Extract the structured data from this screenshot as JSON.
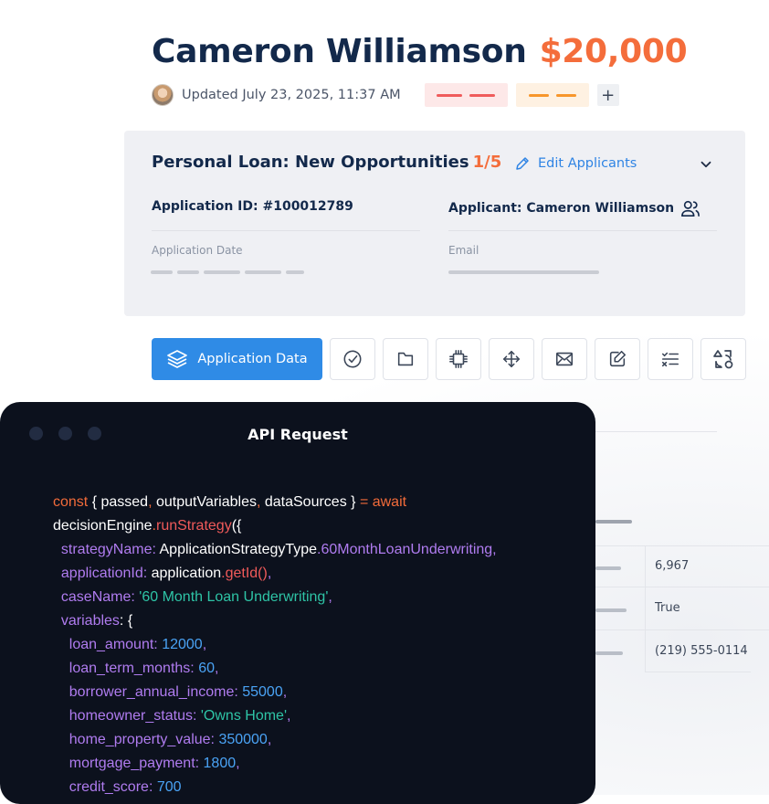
{
  "header": {
    "name": "Cameron Williamson",
    "amount": "$20,000",
    "updated": "Updated July 23, 2025, 11:37 AM",
    "add_label": "+"
  },
  "card": {
    "title": "Personal Loan: New Opportunities",
    "count": "1/5",
    "edit_label": "Edit Applicants",
    "application_id": "Application ID: #100012789",
    "applicant": "Applicant: Cameron Williamson",
    "application_date_label": "Application Date",
    "email_label": "Email"
  },
  "toolbar": {
    "primary_label": "Application  Data",
    "icons": [
      "check-circle-icon",
      "folder-icon",
      "chip-icon",
      "move-icon",
      "mail-icon",
      "edit-note-icon",
      "checklist-icon",
      "shapes-icon"
    ]
  },
  "table": {
    "values": [
      "6,967",
      "True",
      "(219) 555-0114"
    ]
  },
  "code_panel": {
    "title": "API Request",
    "tokens": {
      "t1": "const",
      "t2": " { ",
      "t3": "passed",
      "t4": ", ",
      "t5": "outputVariables",
      "t6": ", ",
      "t7": "dataSources",
      "t8": " } ",
      "t9": "= await",
      "t10": "decisionEngine",
      "t11": ".",
      "t12": "runStrategy",
      "t13": "({",
      "t14": "strategyName",
      "t15": ": ",
      "t16": "ApplicationStrategyType",
      "t17": ".",
      "t18": "60MonthLoanUnderwriting",
      "t19": ",",
      "t20": "applicationId",
      "t21": ": ",
      "t22": "application",
      "t23": ".",
      "t24": "getId()",
      "t25": ",",
      "t26": "caseName",
      "t27": ": ",
      "t28": "'60 Month Loan Underwriting'",
      "t29": ",",
      "t30": "variables",
      "t31": ": {",
      "t32": "loan_amount",
      "t33": ": ",
      "t34": "12000",
      "t35": ",",
      "t36": "loan_term_months",
      "t37": ": ",
      "t38": "60",
      "t39": ",",
      "t40": "borrower_annual_income",
      "t41": ": ",
      "t42": "55000",
      "t43": ",",
      "t44": "homeowner_status",
      "t45": ": ",
      "t46": "'Owns Home'",
      "t47": ",",
      "t48": "home_property_value",
      "t49": ": ",
      "t50": "350000",
      "t51": ",",
      "t52": "mortgage_payment",
      "t53": ": ",
      "t54": "1800",
      "t55": ",",
      "t56": "credit_score",
      "t57": ": ",
      "t58": "700"
    }
  },
  "colors": {
    "navy": "#13294b",
    "orange": "#f46d3b",
    "blue": "#2f8be6",
    "panel_bg": "#0c111d"
  }
}
